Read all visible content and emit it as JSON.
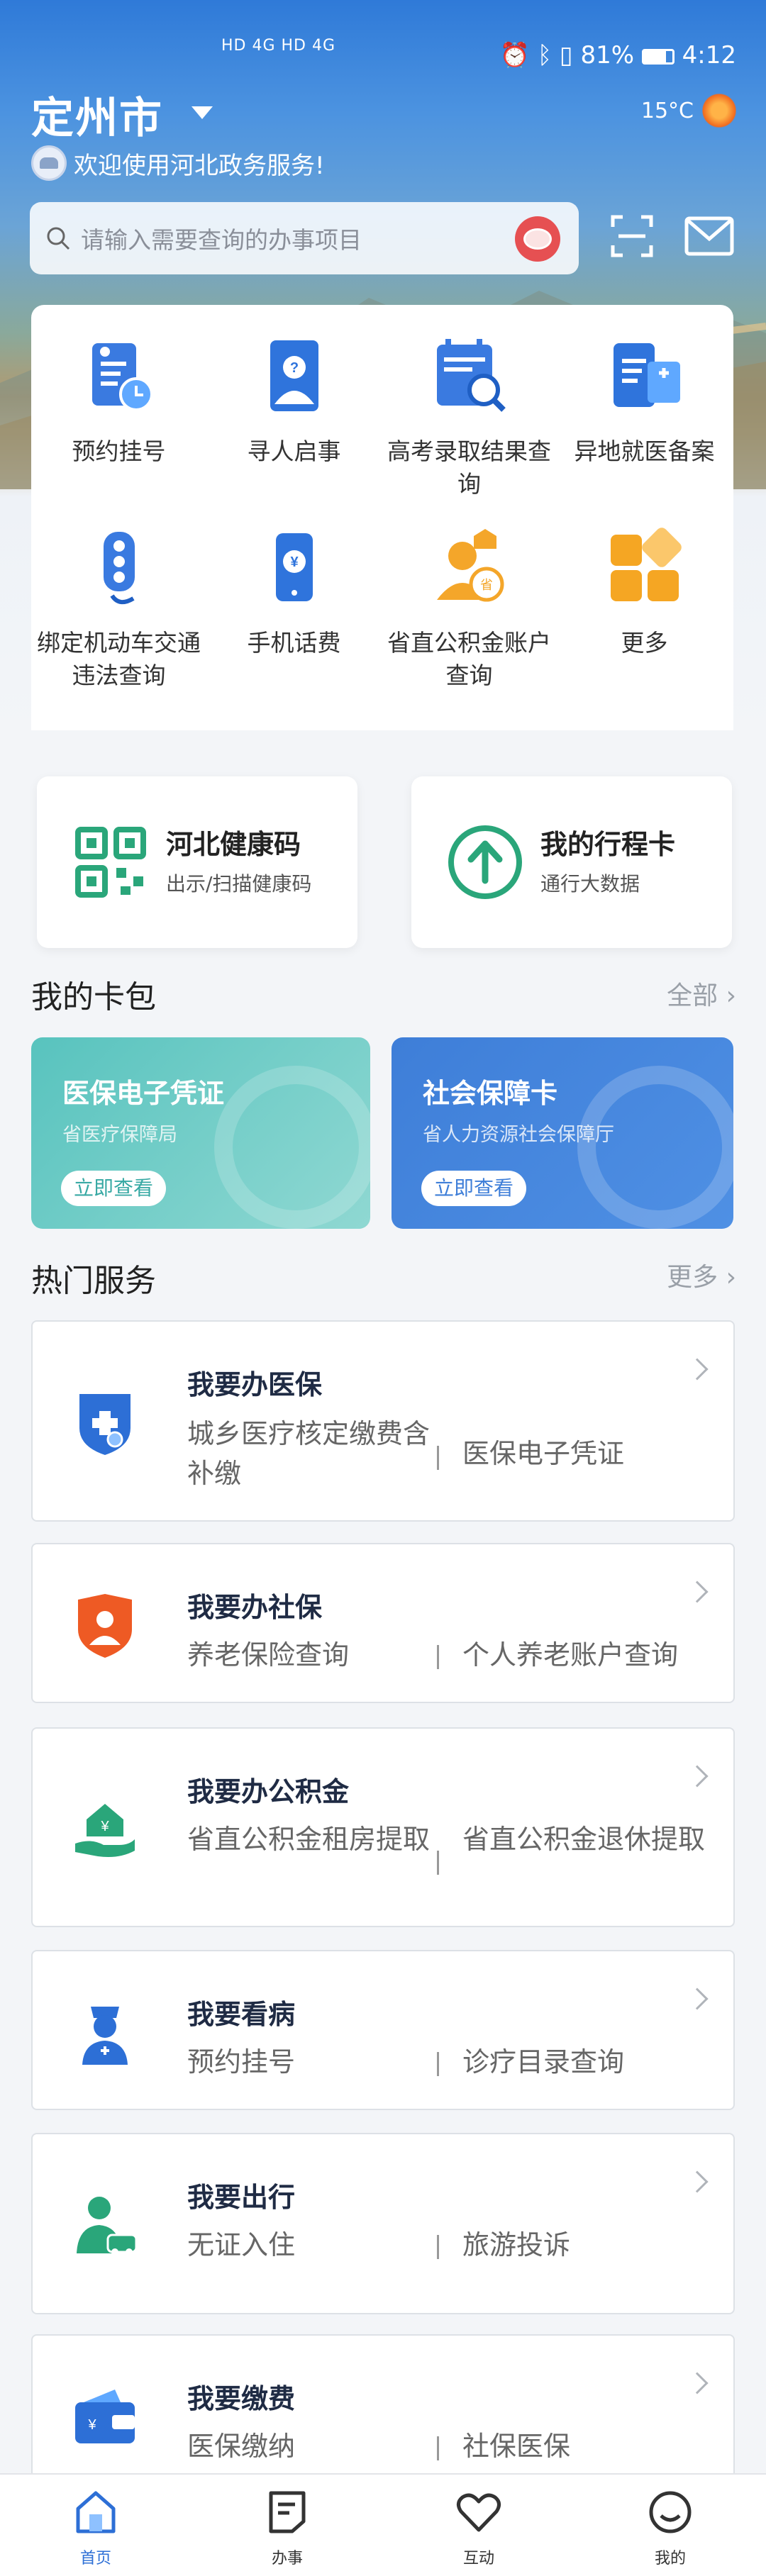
{
  "status_bar": {
    "signal": "HD 4G HD 4G",
    "battery": "81%",
    "time": "4:12"
  },
  "header": {
    "city": "定州市",
    "temperature": "15°C",
    "welcome": "欢迎使用河北政务服务!"
  },
  "search": {
    "placeholder": "请输入需要查询的办事项目"
  },
  "quick_grid": [
    {
      "label": "预约挂号",
      "icon": "registration-clock-icon"
    },
    {
      "label": "寻人启事",
      "icon": "missing-person-icon"
    },
    {
      "label": "高考录取结果查询",
      "icon": "exam-result-search-icon"
    },
    {
      "label": "异地就医备案",
      "icon": "remote-medical-filing-icon"
    },
    {
      "label": "绑定机动车交通违法查询",
      "icon": "traffic-light-icon"
    },
    {
      "label": "手机话费",
      "icon": "phone-bill-icon"
    },
    {
      "label": "省直公积金账户查询",
      "icon": "provident-fund-icon"
    },
    {
      "label": "更多",
      "icon": "more-grid-icon"
    }
  ],
  "health_cards": [
    {
      "title": "河北健康码",
      "subtitle": "出示/扫描健康码"
    },
    {
      "title": "我的行程卡",
      "subtitle": "通行大数据"
    }
  ],
  "wallet": {
    "title": "我的卡包",
    "more": "全部",
    "cards": [
      {
        "title": "医保电子凭证",
        "subtitle": "省医疗保障局",
        "button": "立即查看",
        "color": "#5ec6c4"
      },
      {
        "title": "社会保障卡",
        "subtitle": "省人力资源社会保障厅",
        "button": "立即查看",
        "color": "#3f82dc"
      }
    ]
  },
  "hot_services": {
    "title": "热门服务",
    "more": "更多",
    "items": [
      {
        "title": "我要办医保",
        "left": "城乡医疗核定缴费含补缴",
        "right": "医保电子凭证",
        "icon": "medical-insurance-shield-icon"
      },
      {
        "title": "我要办社保",
        "left": "养老保险查询",
        "right": "个人养老账户查询",
        "icon": "social-security-badge-icon"
      },
      {
        "title": "我要办公积金",
        "left": "省直公积金租房提取",
        "right": "省直公积金退休提取",
        "icon": "housing-fund-hand-icon"
      },
      {
        "title": "我要看病",
        "left": "预约挂号",
        "right": "诊疗目录查询",
        "icon": "nurse-icon"
      },
      {
        "title": "我要出行",
        "left": "无证入住",
        "right": "旅游投诉",
        "icon": "traveler-car-icon"
      },
      {
        "title": "我要缴费",
        "left": "医保缴纳",
        "right": "社保医保",
        "icon": "wallet-payment-icon"
      }
    ]
  },
  "tabbar": [
    {
      "label": "首页",
      "icon": "home-icon",
      "active": true
    },
    {
      "label": "办事",
      "icon": "document-icon",
      "active": false
    },
    {
      "label": "互动",
      "icon": "heart-icon",
      "active": false
    },
    {
      "label": "我的",
      "icon": "smile-icon",
      "active": false
    }
  ],
  "colors": {
    "primary": "#2d6fd6",
    "wallet_teal": "#5ec6c4",
    "wallet_blue": "#3f82dc"
  }
}
